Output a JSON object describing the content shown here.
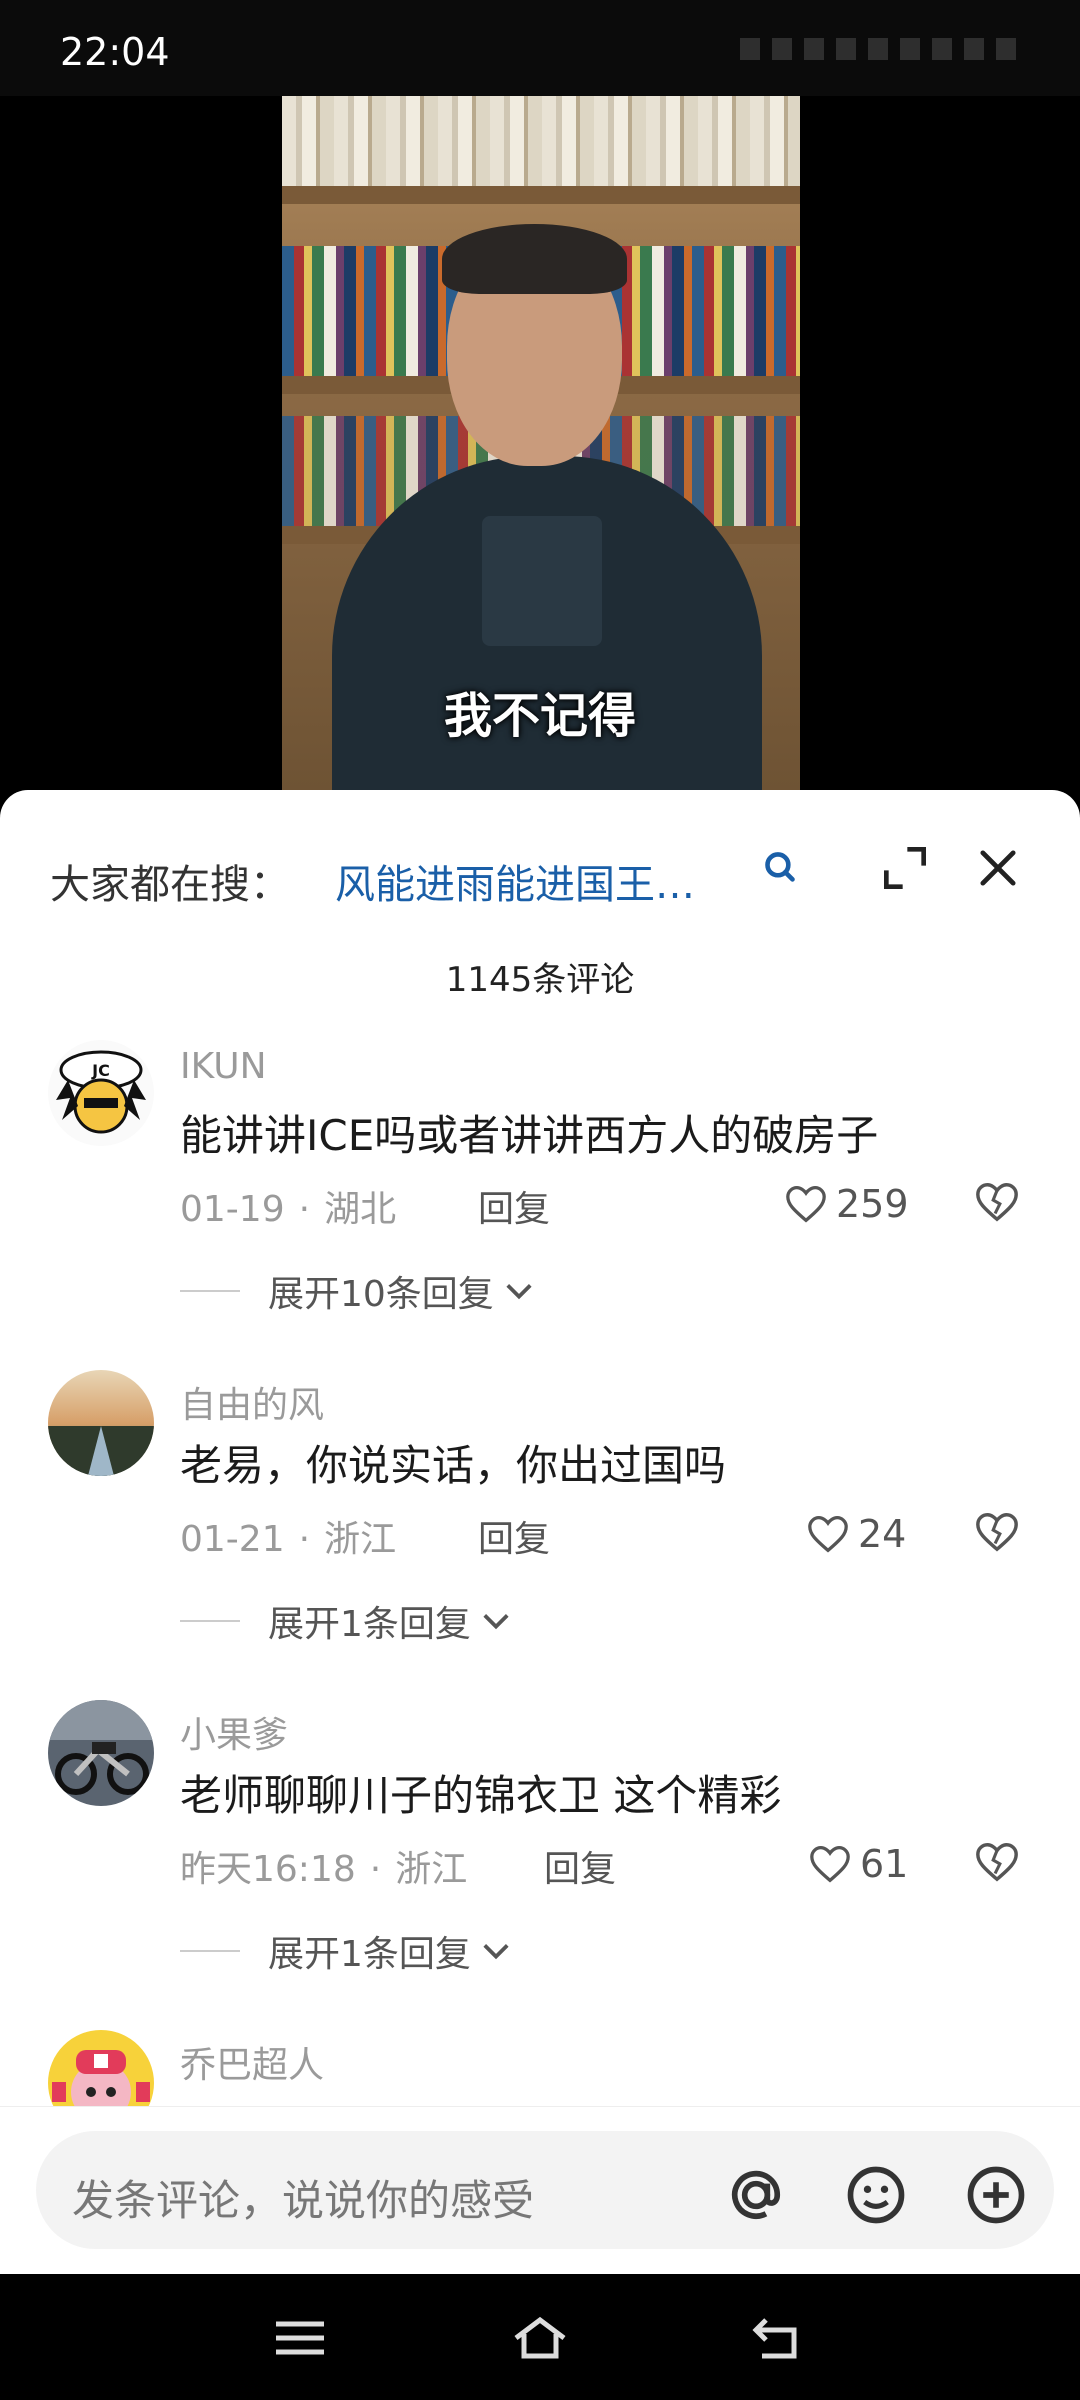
{
  "status_bar": {
    "time": "22:04"
  },
  "video": {
    "subtitle": "我不记得"
  },
  "search": {
    "label": "大家都在搜：",
    "query": "风能进雨能进国王…",
    "icons": {
      "search": "search-icon",
      "expand": "expand-icon",
      "close": "close-icon"
    }
  },
  "comment_count": "1145条评论",
  "comments": [
    {
      "username": "IKUN",
      "text": "能讲讲ICE吗或者讲讲西方人的破房子",
      "date": "01-19",
      "location": "湖北",
      "reply_label": "回复",
      "likes": "259",
      "expand_label": "展开10条回复"
    },
    {
      "username": "自由的风",
      "text": "老易，你说实话，你出过国吗",
      "date": "01-21",
      "location": "浙江",
      "reply_label": "回复",
      "likes": "24",
      "expand_label": "展开1条回复"
    },
    {
      "username": "小果爹",
      "text": "老师聊聊川子的锦衣卫 这个精彩",
      "date": "昨天16:18",
      "location": "浙江",
      "reply_label": "回复",
      "likes": "61",
      "expand_label": "展开1条回复"
    },
    {
      "username": "乔巴超人"
    }
  ],
  "input": {
    "placeholder": "发条评论，说说你的感受",
    "icons": [
      "at-icon",
      "emoji-icon",
      "plus-icon"
    ]
  },
  "nav": {
    "icons": [
      "menu-icon",
      "home-icon",
      "back-icon"
    ]
  },
  "colors": {
    "link": "#1a5fa8",
    "muted": "#9a9a9a",
    "text": "#1b1b1b"
  }
}
